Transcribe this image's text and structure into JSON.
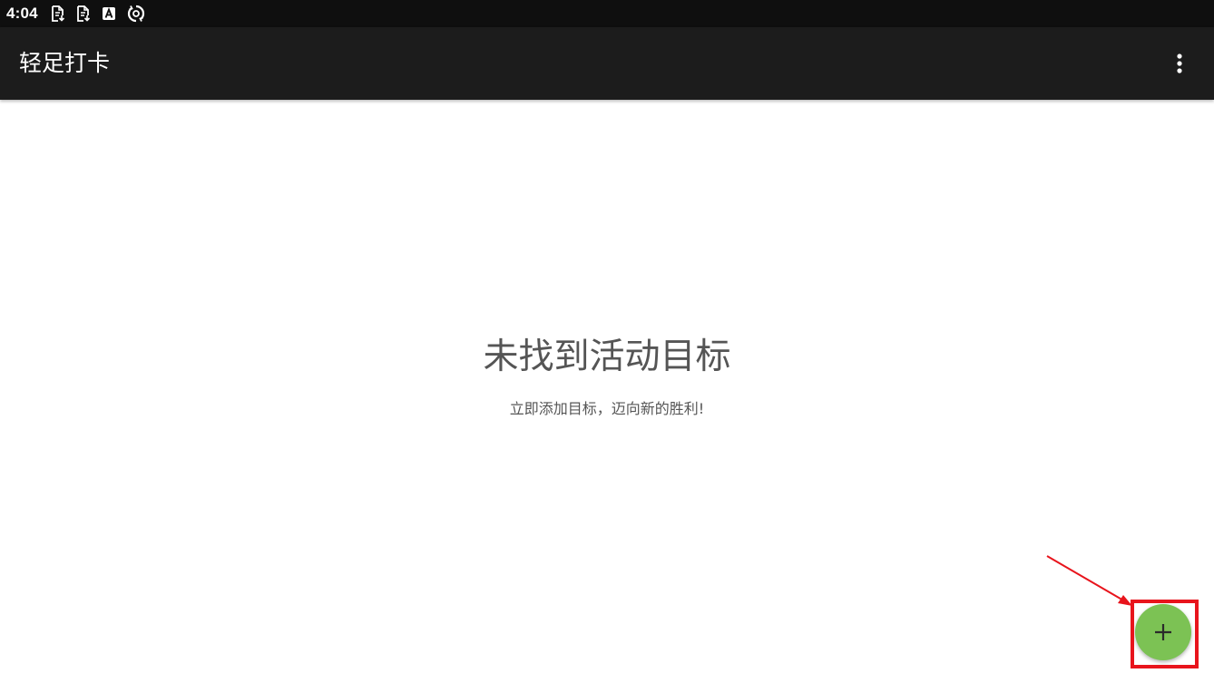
{
  "status_bar": {
    "time": "4:04",
    "icons": [
      "document-download-icon",
      "document-download-icon",
      "keyboard-a-icon",
      "sync-app-icon"
    ]
  },
  "app_bar": {
    "title": "轻足打卡",
    "menu_icon": "more-vert-icon"
  },
  "empty_state": {
    "title": "未找到活动目标",
    "subtitle": "立即添加目标，迈向新的胜利!"
  },
  "fab": {
    "icon": "plus-icon",
    "color": "#7cc254"
  },
  "annotation": {
    "color": "#e8141c"
  }
}
